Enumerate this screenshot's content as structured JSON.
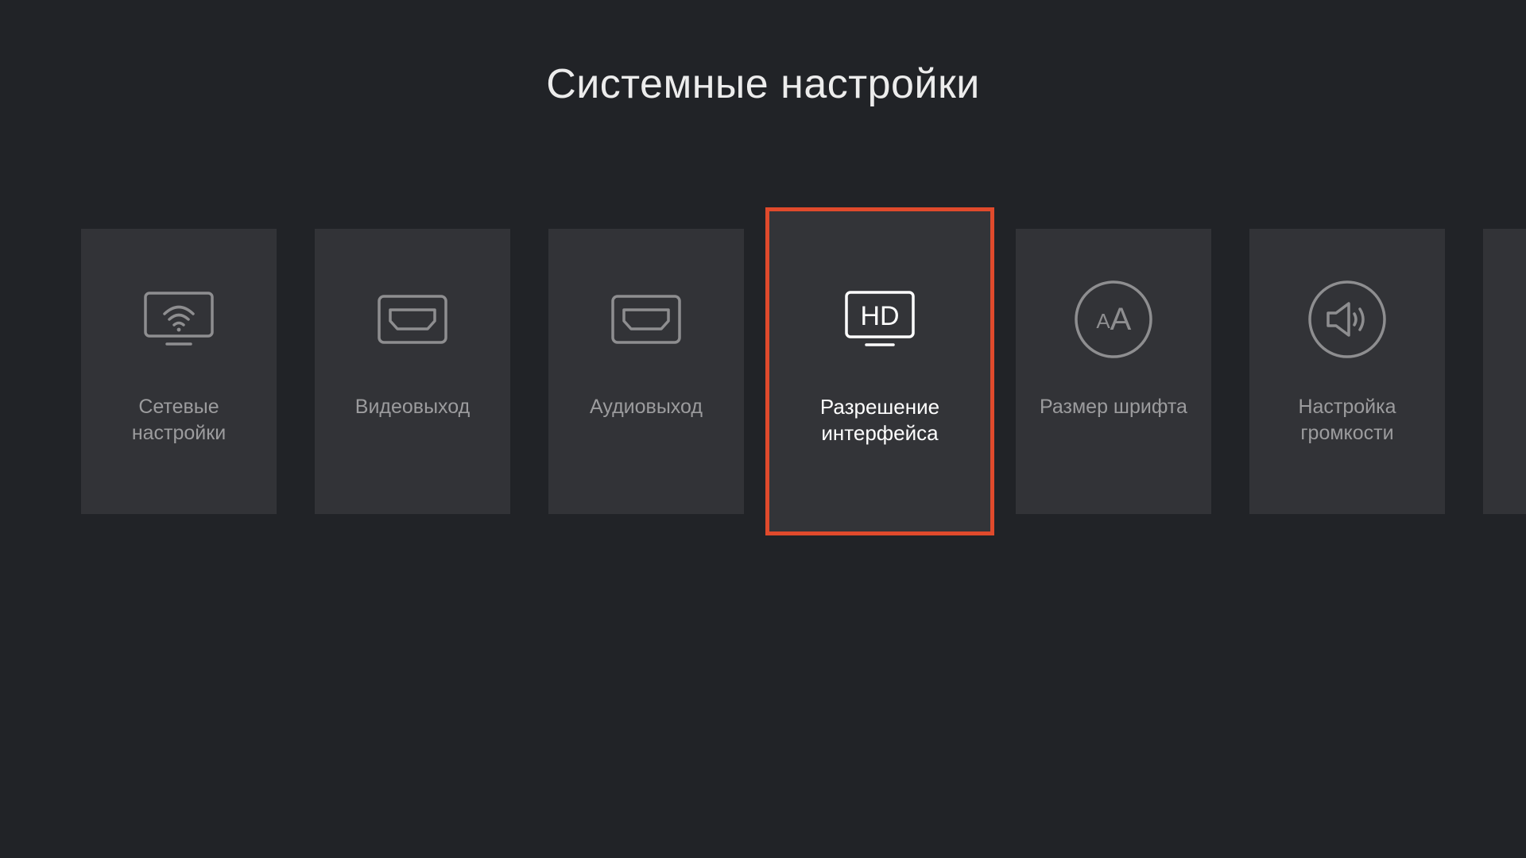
{
  "title": "Системные настройки",
  "tiles": [
    {
      "id": "network",
      "label": "Сетевые настройки",
      "icon": "wifi-monitor-icon",
      "selected": false
    },
    {
      "id": "video",
      "label": "Видеовыход",
      "icon": "hdmi-port-icon",
      "selected": false
    },
    {
      "id": "audio",
      "label": "Аудиовыход",
      "icon": "hdmi-port-icon",
      "selected": false
    },
    {
      "id": "resolution",
      "label": "Разрешение интерфейса",
      "icon": "hd-monitor-icon",
      "selected": true
    },
    {
      "id": "font-size",
      "label": "Размер шрифта",
      "icon": "font-size-icon",
      "selected": false
    },
    {
      "id": "volume",
      "label": "Настройка громкости",
      "icon": "speaker-volume-icon",
      "selected": false
    }
  ],
  "colors": {
    "background": "#212327",
    "tile": "#323337",
    "accent": "#e04a2c",
    "label": "#9c9c9e",
    "label_selected": "#ffffff"
  }
}
